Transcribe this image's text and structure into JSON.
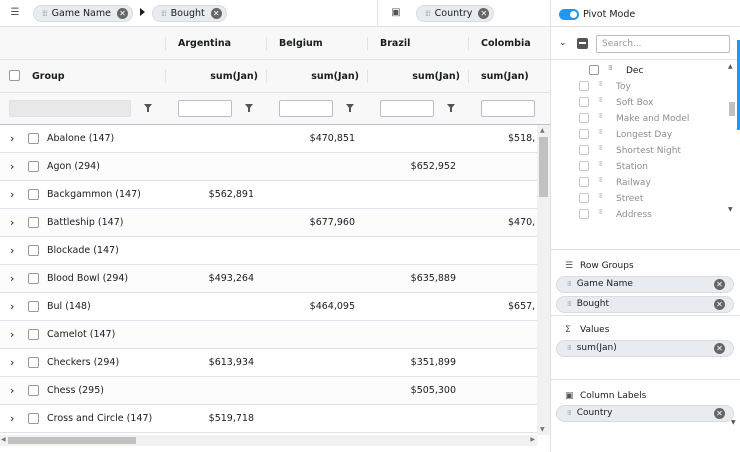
{
  "toolbar": {
    "row_groups_chips": [
      {
        "label": "Game Name"
      },
      {
        "label": "Bought"
      }
    ],
    "column_chips": [
      {
        "label": "Country"
      }
    ]
  },
  "pivot": {
    "mode_label": "Pivot Mode",
    "enabled": true
  },
  "grid": {
    "group_header": "Group",
    "countries": [
      "Argentina",
      "Belgium",
      "Brazil",
      "Colombia"
    ],
    "agg_header": "sum(Jan)",
    "rows": [
      {
        "name": "Abalone (147)",
        "values": [
          "",
          "$470,851",
          "",
          "$518,"
        ]
      },
      {
        "name": "Agon (294)",
        "values": [
          "",
          "",
          "$652,952",
          ""
        ]
      },
      {
        "name": "Backgammon (147)",
        "values": [
          "$562,891",
          "",
          "",
          ""
        ]
      },
      {
        "name": "Battleship (147)",
        "values": [
          "",
          "$677,960",
          "",
          "$470,"
        ]
      },
      {
        "name": "Blockade (147)",
        "values": [
          "",
          "",
          "",
          ""
        ]
      },
      {
        "name": "Blood Bowl (294)",
        "values": [
          "$493,264",
          "",
          "$635,889",
          ""
        ]
      },
      {
        "name": "Bul (148)",
        "values": [
          "",
          "$464,095",
          "",
          "$657,"
        ]
      },
      {
        "name": "Camelot (147)",
        "values": [
          "",
          "",
          "",
          ""
        ]
      },
      {
        "name": "Checkers (294)",
        "values": [
          "$613,934",
          "",
          "$351,899",
          ""
        ]
      },
      {
        "name": "Chess (295)",
        "values": [
          "",
          "",
          "$505,300",
          ""
        ]
      },
      {
        "name": "Cross and Circle (147)",
        "values": [
          "$519,718",
          "",
          "",
          ""
        ]
      }
    ]
  },
  "panel": {
    "search_placeholder": "Search...",
    "columns": [
      "Dec",
      "Toy",
      "Soft Box",
      "Make and Model",
      "Longest Day",
      "Shortest Night",
      "Station",
      "Railway",
      "Street",
      "Address"
    ],
    "row_groups_title": "Row Groups",
    "row_groups": [
      "Game Name",
      "Bought"
    ],
    "values_title": "Values",
    "values": [
      "sum(Jan)"
    ],
    "column_labels_title": "Column Labels",
    "column_labels": [
      "Country"
    ]
  }
}
